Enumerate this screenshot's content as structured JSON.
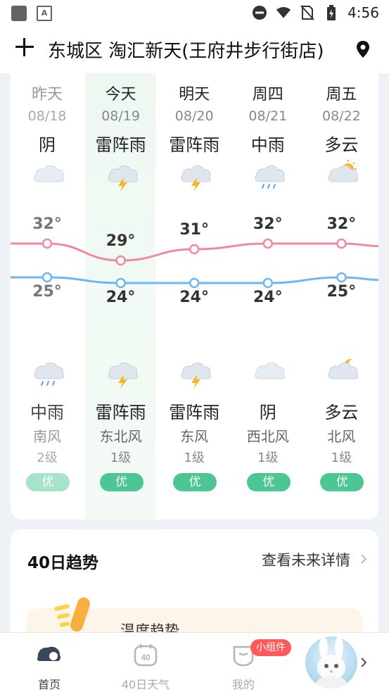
{
  "status_bar": {
    "time": "4:56",
    "left_icons": [
      "app-square-icon",
      "translate-a-icon"
    ],
    "right_icons": [
      "do-not-disturb-icon",
      "wifi-icon",
      "no-sim-icon",
      "battery-charging-icon"
    ]
  },
  "header": {
    "title": "东城区 淘汇新天(王府井步行街店)",
    "add_icon": "plus-icon",
    "location_icon": "location-pin-icon"
  },
  "forecast": {
    "days": [
      {
        "name": "昨天",
        "date": "08/18",
        "day_cond": "阴",
        "day_icon": "cloudy-icon",
        "high": "32°",
        "low": "25°",
        "night_cond": "中雨",
        "night_icon": "moderate-rain-icon",
        "wind_dir": "南风",
        "wind_level": "2级",
        "aqi": "优"
      },
      {
        "name": "今天",
        "date": "08/19",
        "day_cond": "雷阵雨",
        "day_icon": "thunderstorm-icon",
        "high": "29°",
        "low": "24°",
        "night_cond": "雷阵雨",
        "night_icon": "thunderstorm-icon",
        "wind_dir": "东北风",
        "wind_level": "1级",
        "aqi": "优"
      },
      {
        "name": "明天",
        "date": "08/20",
        "day_cond": "雷阵雨",
        "day_icon": "thunderstorm-icon",
        "high": "31°",
        "low": "24°",
        "night_cond": "雷阵雨",
        "night_icon": "thunderstorm-icon",
        "wind_dir": "东风",
        "wind_level": "1级",
        "aqi": "优"
      },
      {
        "name": "周四",
        "date": "08/21",
        "day_cond": "中雨",
        "day_icon": "moderate-rain-icon",
        "high": "32°",
        "low": "24°",
        "night_cond": "阴",
        "night_icon": "cloudy-icon",
        "wind_dir": "西北风",
        "wind_level": "1级",
        "aqi": "优"
      },
      {
        "name": "周五",
        "date": "08/22",
        "day_cond": "多云",
        "day_icon": "partly-cloudy-day-icon",
        "high": "32°",
        "low": "25°",
        "night_cond": "多云",
        "night_icon": "partly-cloudy-night-icon",
        "wind_dir": "北风",
        "wind_level": "1级",
        "aqi": "优"
      }
    ],
    "high_values": [
      32,
      29,
      31,
      32,
      32
    ],
    "low_values": [
      25,
      24,
      24,
      24,
      25
    ],
    "colors": {
      "high_line": "#f28a9b",
      "low_line": "#6fb6f3",
      "aqi_good": "#4cc794"
    }
  },
  "trend": {
    "title": "40日趋势",
    "more_label": "查看未来详情",
    "banner_text": "温度趋势"
  },
  "bottom_nav": {
    "items": [
      {
        "label": "首页",
        "icon": "home-cloud-icon",
        "active": true
      },
      {
        "label": "40日天气",
        "icon": "calendar-40-icon",
        "active": false
      },
      {
        "label": "我的",
        "icon": "profile-cup-icon",
        "active": false
      }
    ],
    "widget_badge": "小组件"
  }
}
